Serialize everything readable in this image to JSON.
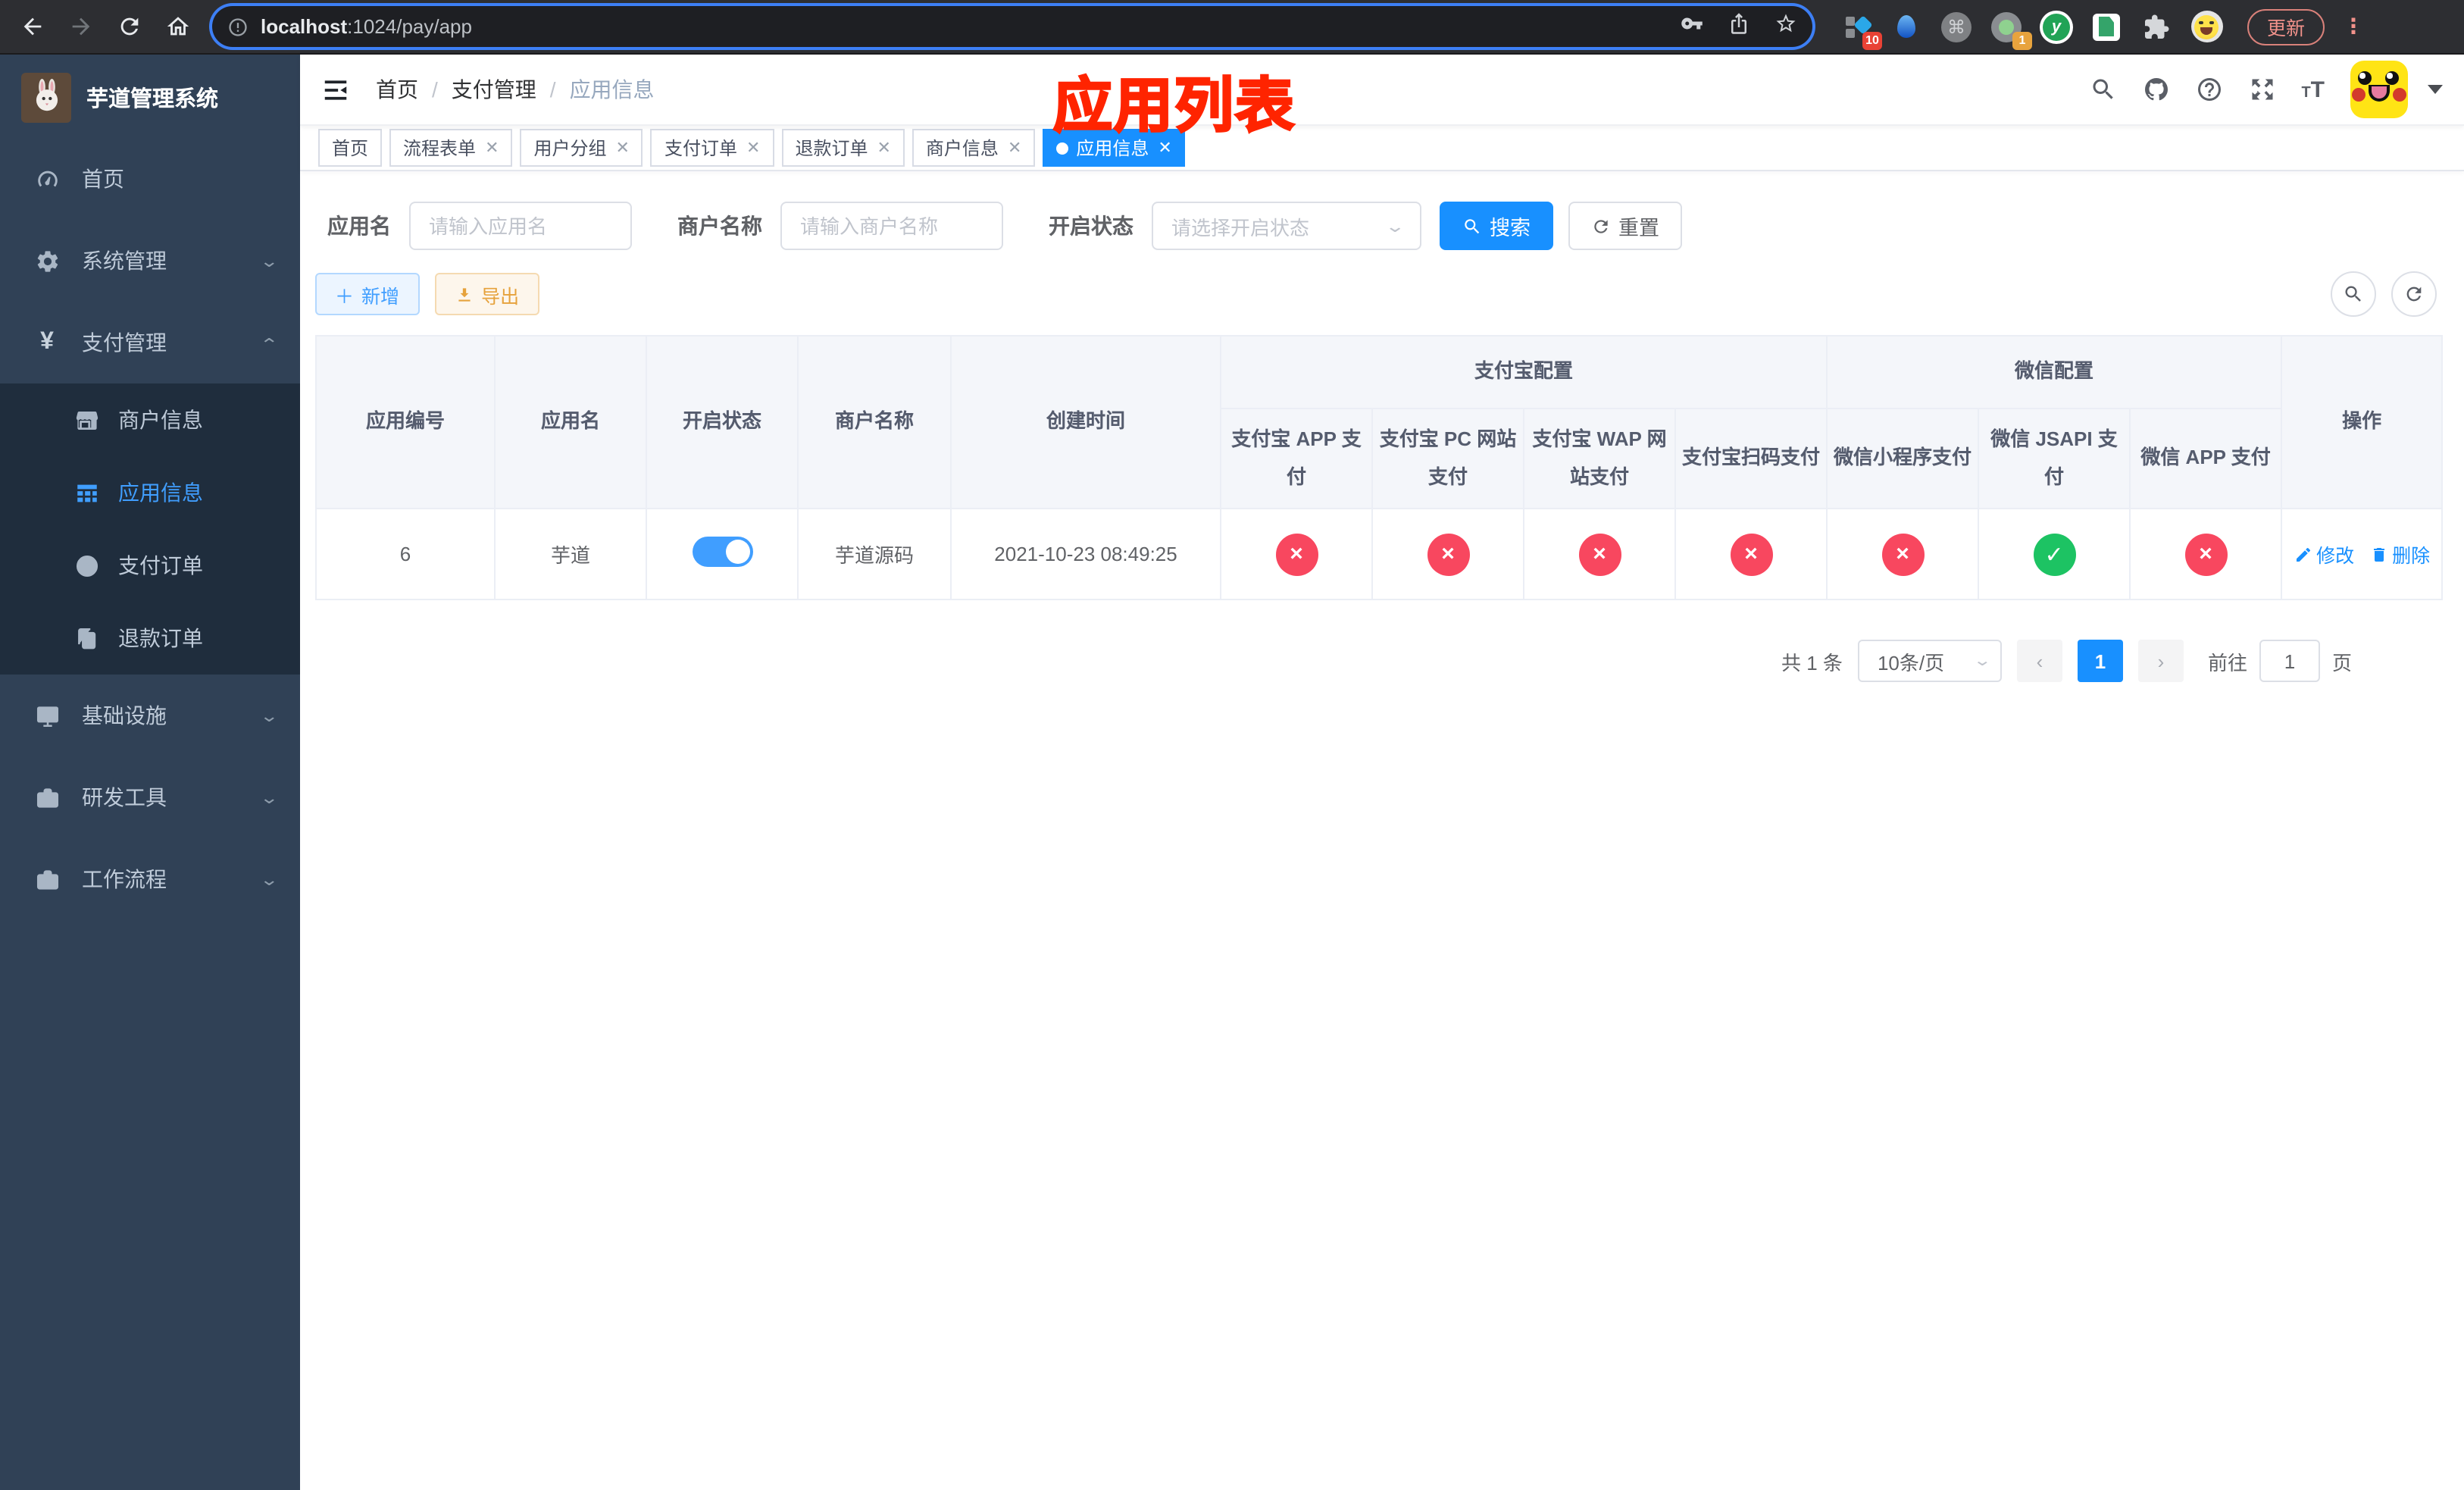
{
  "browser": {
    "url_host": "localhost",
    "url_path": ":1024/pay/app",
    "update_label": "更新",
    "ext_badge_tiles": "10",
    "ext_badge_lens": "1",
    "ext_y_letter": "y",
    "cmd_glyph": "⌘"
  },
  "sidebar": {
    "title": "芋道管理系统",
    "items": [
      {
        "label": "首页"
      },
      {
        "label": "系统管理"
      },
      {
        "label": "支付管理"
      },
      {
        "label": "商户信息"
      },
      {
        "label": "应用信息"
      },
      {
        "label": "支付订单"
      },
      {
        "label": "退款订单"
      },
      {
        "label": "基础设施"
      },
      {
        "label": "研发工具"
      },
      {
        "label": "工作流程"
      }
    ]
  },
  "header": {
    "breadcrumb": [
      "首页",
      "支付管理",
      "应用信息"
    ]
  },
  "annotation": "应用列表",
  "tabs": [
    {
      "label": "首页"
    },
    {
      "label": "流程表单"
    },
    {
      "label": "用户分组"
    },
    {
      "label": "支付订单"
    },
    {
      "label": "退款订单"
    },
    {
      "label": "商户信息"
    },
    {
      "label": "应用信息"
    }
  ],
  "filters": {
    "app_name_label": "应用名",
    "app_name_placeholder": "请输入应用名",
    "merchant_label": "商户名称",
    "merchant_placeholder": "请输入商户名称",
    "status_label": "开启状态",
    "status_placeholder": "请选择开启状态",
    "search_label": "搜索",
    "reset_label": "重置"
  },
  "toolbar": {
    "add_label": "新增",
    "export_label": "导出"
  },
  "table": {
    "group_alipay": "支付宝配置",
    "group_wechat": "微信配置",
    "col_app_id": "应用编号",
    "col_app_name": "应用名",
    "col_status": "开启状态",
    "col_merchant": "商户名称",
    "col_created": "创建时间",
    "col_actions": "操作",
    "pay_cols": [
      "支付宝 APP 支付",
      "支付宝 PC 网站支付",
      "支付宝 WAP 网站支付",
      "支付宝扫码支付",
      "微信小程序支付",
      "微信 JSAPI 支付",
      "微信 APP 支付"
    ],
    "status_glyphs": {
      "fail": "×",
      "success": "✓"
    },
    "row": {
      "app_id": "6",
      "app_name": "芋道",
      "status_on": true,
      "merchant": "芋道源码",
      "created": "2021-10-23 08:49:25",
      "pay_status": [
        "fail",
        "fail",
        "fail",
        "fail",
        "fail",
        "success",
        "fail"
      ],
      "edit_label": "修改",
      "delete_label": "删除"
    }
  },
  "pagination": {
    "total_label": "共 1 条",
    "page_size": "10条/页",
    "current_page": "1",
    "goto_label": "前往",
    "goto_value": "1",
    "page_label": "页"
  },
  "colors": {
    "accent": "#1890ff",
    "link": "#409eff",
    "success": "#1dc363",
    "danger": "#f8475f",
    "warning": "#e6a23c",
    "sidebar_bg": "#304156",
    "sidebar_submenu_bg": "#1f2d3d",
    "annotation_red": "#ff2400"
  }
}
